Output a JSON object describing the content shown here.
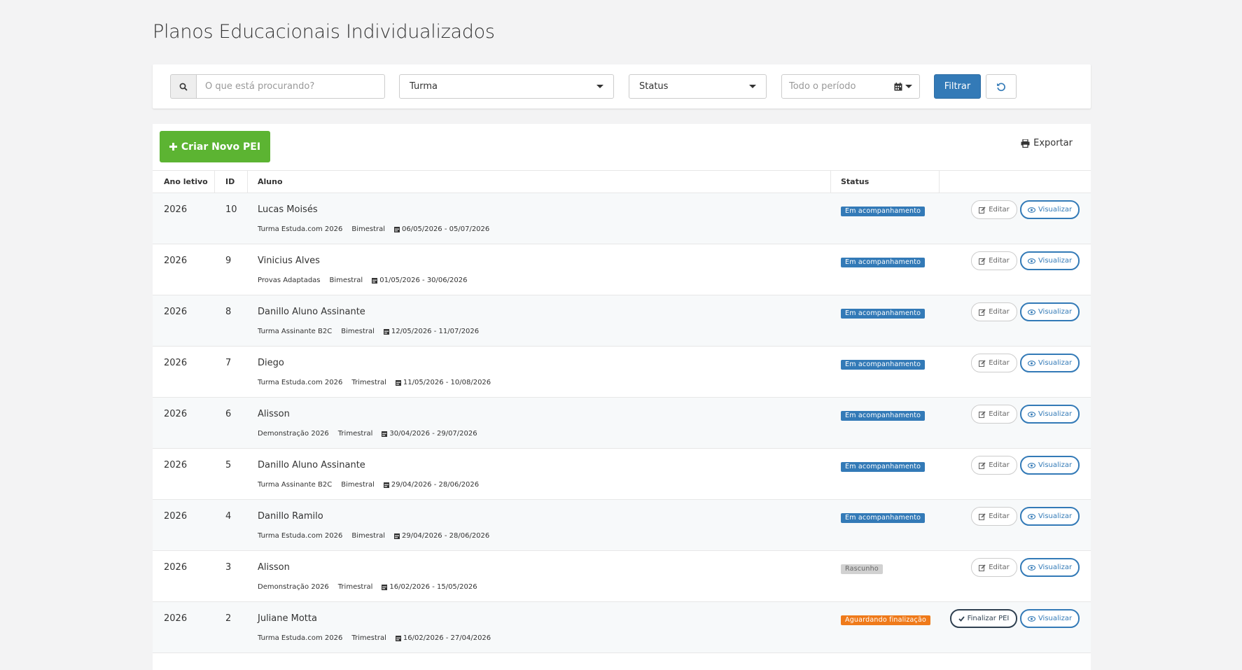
{
  "page_title": "Planos Educacionais Individualizados",
  "filters": {
    "search_placeholder": "O que está procurando?",
    "turma": "Turma",
    "status": "Status",
    "period_placeholder": "Todo o período",
    "filter_button": "Filtrar"
  },
  "toolbar": {
    "create_button": "Criar Novo PEI",
    "export": "Exportar"
  },
  "table": {
    "headers": {
      "year": "Ano letivo",
      "id": "ID",
      "student": "Aluno",
      "status": "Status"
    },
    "edit_label": "Editar",
    "view_label": "Visualizar",
    "finalize_label": "Finalizar PEI",
    "rows": [
      {
        "year": "2026",
        "id": "10",
        "student": "Lucas Moisés",
        "turma": "Turma Estuda.com 2026",
        "period": "Bimestral",
        "dates": "06/05/2026 - 05/07/2026",
        "status": "Em acompanhamento",
        "status_type": "blue",
        "primary_action": "edit"
      },
      {
        "year": "2026",
        "id": "9",
        "student": "Vinicius Alves",
        "turma": "Provas Adaptadas",
        "period": "Bimestral",
        "dates": "01/05/2026 - 30/06/2026",
        "status": "Em acompanhamento",
        "status_type": "blue",
        "primary_action": "edit"
      },
      {
        "year": "2026",
        "id": "8",
        "student": "Danillo Aluno Assinante",
        "turma": "Turma Assinante B2C",
        "period": "Bimestral",
        "dates": "12/05/2026 - 11/07/2026",
        "status": "Em acompanhamento",
        "status_type": "blue",
        "primary_action": "edit"
      },
      {
        "year": "2026",
        "id": "7",
        "student": "Diego",
        "turma": "Turma Estuda.com 2026",
        "period": "Trimestral",
        "dates": "11/05/2026 - 10/08/2026",
        "status": "Em acompanhamento",
        "status_type": "blue",
        "primary_action": "edit"
      },
      {
        "year": "2026",
        "id": "6",
        "student": "Alisson",
        "turma": "Demonstração 2026",
        "period": "Trimestral",
        "dates": "30/04/2026 - 29/07/2026",
        "status": "Em acompanhamento",
        "status_type": "blue",
        "primary_action": "edit"
      },
      {
        "year": "2026",
        "id": "5",
        "student": "Danillo Aluno Assinante",
        "turma": "Turma Assinante B2C",
        "period": "Bimestral",
        "dates": "29/04/2026 - 28/06/2026",
        "status": "Em acompanhamento",
        "status_type": "blue",
        "primary_action": "edit"
      },
      {
        "year": "2026",
        "id": "4",
        "student": "Danillo Ramilo",
        "turma": "Turma Estuda.com 2026",
        "period": "Bimestral",
        "dates": "29/04/2026 - 28/06/2026",
        "status": "Em acompanhamento",
        "status_type": "blue",
        "primary_action": "edit"
      },
      {
        "year": "2026",
        "id": "3",
        "student": "Alisson",
        "turma": "Demonstração 2026",
        "period": "Trimestral",
        "dates": "16/02/2026 - 15/05/2026",
        "status": "Rascunho",
        "status_type": "gray",
        "primary_action": "edit"
      },
      {
        "year": "2026",
        "id": "2",
        "student": "Juliane Motta",
        "turma": "Turma Estuda.com 2026",
        "period": "Trimestral",
        "dates": "16/02/2026 - 27/04/2026",
        "status": "Aguardando finalização",
        "status_type": "orange",
        "primary_action": "finalize"
      }
    ]
  },
  "colors": {
    "primary": "#337ab7",
    "success": "#5cb432",
    "warning": "#ef7a1a",
    "draft": "#d1d1d1"
  }
}
